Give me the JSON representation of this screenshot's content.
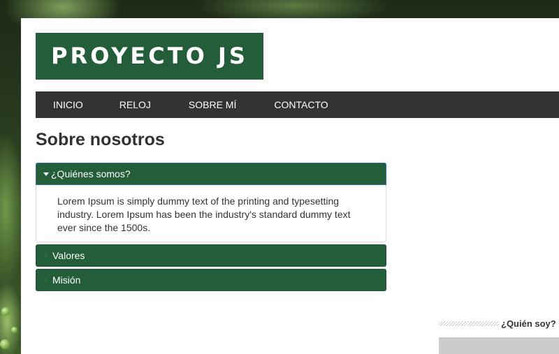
{
  "header": {
    "logo_text": "PROYECTO JS"
  },
  "nav": {
    "items": [
      {
        "label": "INICIO"
      },
      {
        "label": "RELOJ"
      },
      {
        "label": "SOBRE MÍ"
      },
      {
        "label": "CONTACTO"
      }
    ]
  },
  "main": {
    "title": "Sobre nosotros",
    "accordion": [
      {
        "label": "¿Quiénes somos?",
        "expanded": true,
        "content": "Lorem Ipsum is simply dummy text of the printing and typesetting industry. Lorem Ipsum has been the industry's standard dummy text ever since the 1500s."
      },
      {
        "label": "Valores",
        "expanded": false
      },
      {
        "label": "Misión",
        "expanded": false
      }
    ]
  },
  "sidebar": {
    "heading": "¿Quién soy?"
  },
  "colors": {
    "brand_green": "#235d3a",
    "nav_bg": "#333333",
    "active_border": "#2a6bb5"
  }
}
